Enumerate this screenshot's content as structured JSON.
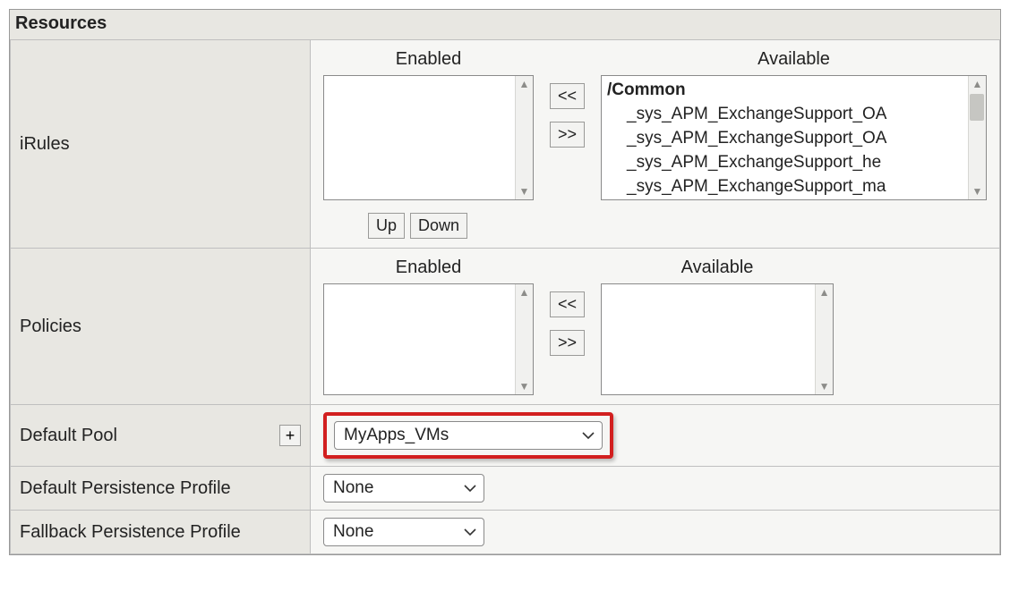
{
  "panel": {
    "title": "Resources"
  },
  "rows": {
    "irules": {
      "label": "iRules",
      "enabled_header": "Enabled",
      "available_header": "Available",
      "move_left": "<<",
      "move_right": ">>",
      "up": "Up",
      "down": "Down",
      "available_group": "/Common",
      "available_items": [
        "_sys_APM_ExchangeSupport_OA",
        "_sys_APM_ExchangeSupport_OA",
        "_sys_APM_ExchangeSupport_he",
        "_sys_APM_ExchangeSupport_ma"
      ]
    },
    "policies": {
      "label": "Policies",
      "enabled_header": "Enabled",
      "available_header": "Available",
      "move_left": "<<",
      "move_right": ">>"
    },
    "default_pool": {
      "label": "Default Pool",
      "plus": "+",
      "value": "MyApps_VMs"
    },
    "default_persistence": {
      "label": "Default Persistence Profile",
      "value": "None"
    },
    "fallback_persistence": {
      "label": "Fallback Persistence Profile",
      "value": "None"
    }
  }
}
